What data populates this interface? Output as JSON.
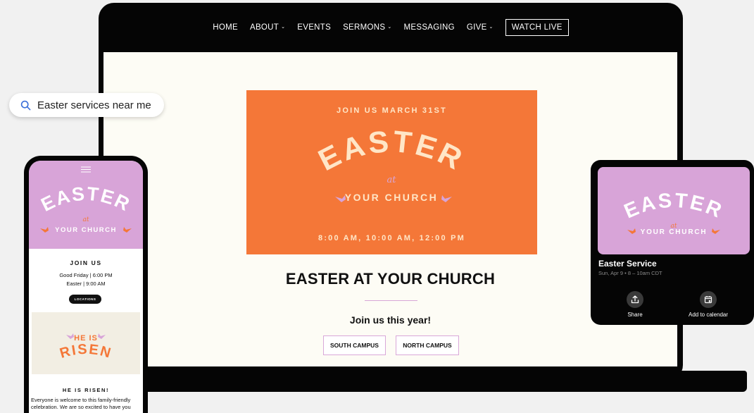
{
  "nav": {
    "items": [
      {
        "label": "HOME",
        "dropdown": false
      },
      {
        "label": "ABOUT",
        "dropdown": true
      },
      {
        "label": "EVENTS",
        "dropdown": false
      },
      {
        "label": "SERMONS",
        "dropdown": true
      },
      {
        "label": "MESSAGING",
        "dropdown": false
      },
      {
        "label": "GIVE",
        "dropdown": true
      }
    ],
    "watch_live": "WATCH LIVE"
  },
  "hero": {
    "top_line": "JOIN US MARCH 31ST",
    "art_word": "EASTER",
    "art_at": "at",
    "art_subline": "YOUR CHURCH",
    "times": "8:00 AM, 10:00 AM, 12:00 PM"
  },
  "page": {
    "headline": "EASTER AT YOUR CHURCH",
    "subhead": "Join us this year!",
    "campus_south": "SOUTH CAMPUS",
    "campus_north": "NORTH CAMPUS"
  },
  "search": {
    "query": "Easter services near me",
    "icon": "search-icon"
  },
  "phone": {
    "join": "JOIN US",
    "line1": "Good Friday | 6:00 PM",
    "line2": "Easter | 9:00 AM",
    "locations": "LOCATIONS",
    "he_is": "HE IS",
    "risen": "RISEN",
    "risen_heading": "HE IS RISEN!",
    "body_line1": "Everyone is welcome to this family-friendly",
    "body_line2": "celebration. We are so excited to have you"
  },
  "card": {
    "title": "Easter Service",
    "subtitle": "Sun, Apr 9 • 8 – 10am CDT",
    "share": "Share",
    "add_to_calendar": "Add to calendar"
  },
  "colors": {
    "orange": "#f47738",
    "lavender": "#d8a4d8",
    "cream": "#ffe6c7",
    "page_bg": "#fdfcf5",
    "device_black": "#050505"
  }
}
